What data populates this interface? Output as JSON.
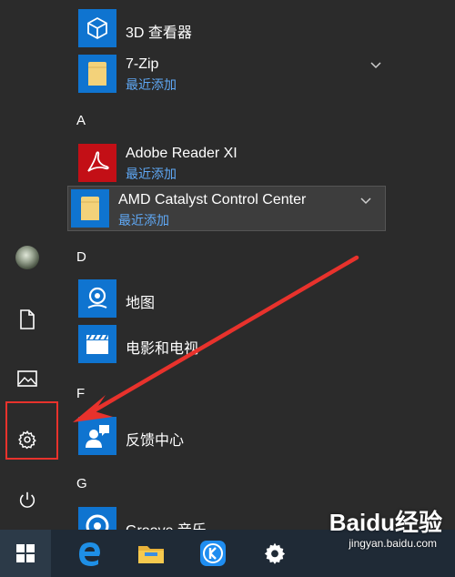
{
  "left_rail": {
    "items": [
      {
        "name": "user-avatar",
        "label": "User"
      },
      {
        "name": "documents-icon",
        "label": "Documents"
      },
      {
        "name": "pictures-icon",
        "label": "Pictures"
      },
      {
        "name": "settings-gear-icon",
        "label": "Settings"
      },
      {
        "name": "power-icon",
        "label": "Power"
      }
    ],
    "highlighted": "settings-gear-icon",
    "highlight_color": "#e8322c"
  },
  "app_list": {
    "items": [
      {
        "type": "app",
        "name": "3D 查看器",
        "icon": "cube-icon"
      },
      {
        "type": "app",
        "name": "7-Zip",
        "subtitle": "最近添加",
        "icon": "folder-icon",
        "expandable": true
      },
      {
        "type": "letter",
        "label": "A"
      },
      {
        "type": "app",
        "name": "Adobe Reader XI",
        "subtitle": "最近添加",
        "icon": "acrobat-icon"
      },
      {
        "type": "app",
        "name": "AMD Catalyst Control Center",
        "subtitle": "最近添加",
        "icon": "folder-icon",
        "expandable": true,
        "selected": true
      },
      {
        "type": "letter",
        "label": "D"
      },
      {
        "type": "app",
        "name": "地图",
        "icon": "map-pin-icon"
      },
      {
        "type": "app",
        "name": "电影和电视",
        "icon": "clapperboard-icon"
      },
      {
        "type": "letter",
        "label": "F"
      },
      {
        "type": "app",
        "name": "反馈中心",
        "icon": "feedback-icon"
      },
      {
        "type": "letter",
        "label": "G"
      },
      {
        "type": "app",
        "name": "Groove 音乐",
        "icon": "groove-disc-icon"
      }
    ],
    "subtitle_color": "#5fa8f5",
    "tile_color": "#0f74d0"
  },
  "annotation": {
    "arrow_color": "#e8322c"
  },
  "taskbar": {
    "items": [
      {
        "name": "windows-start-icon"
      },
      {
        "name": "edge-browser-icon"
      },
      {
        "name": "file-explorer-icon"
      },
      {
        "name": "kugou-music-icon"
      },
      {
        "name": "settings-gear-icon"
      }
    ]
  },
  "watermark": {
    "logo": "Baidu经验",
    "url": "jingyan.baidu.com"
  }
}
